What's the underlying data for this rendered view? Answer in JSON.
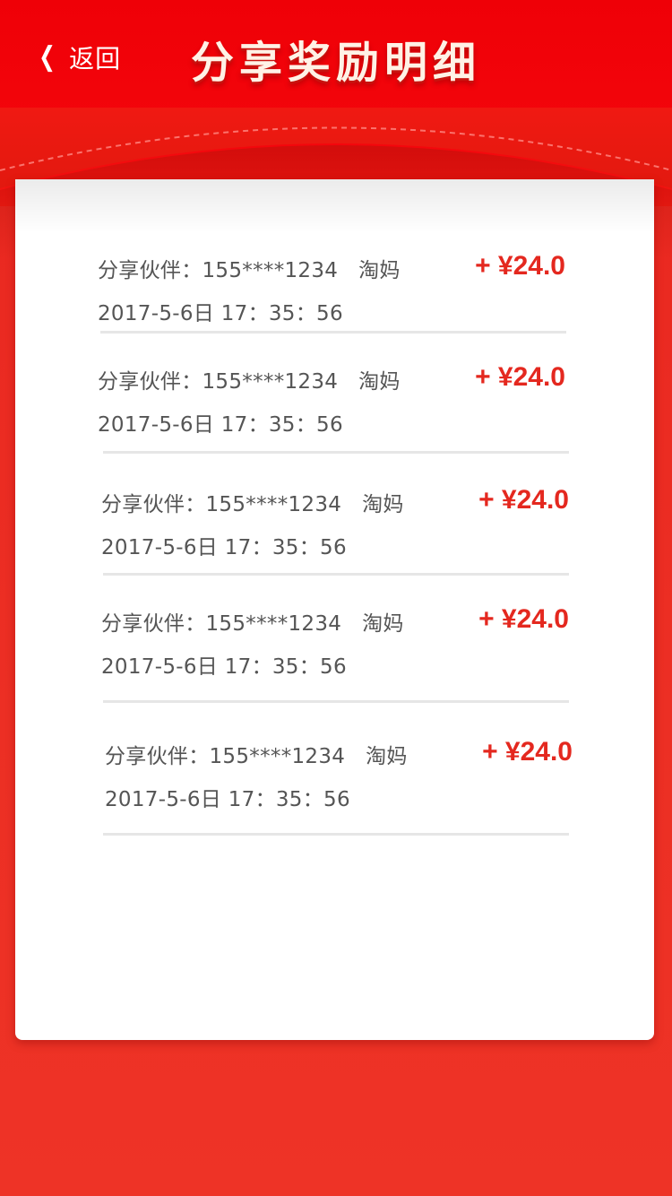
{
  "header": {
    "back_label": "返回",
    "back_icon": "chevron-left-icon",
    "title": "分享奖励明细"
  },
  "colors": {
    "header_red": "#f4060c",
    "background_red": "#ec2f24",
    "amount_red": "#e4281f",
    "text_gray": "#555555"
  },
  "records": [
    {
      "partner_label": "分享伙伴：",
      "phone": "155****1234",
      "platform": "淘妈",
      "time": "2017-5-6日 17：35：56",
      "amount": "+ ¥24.0"
    },
    {
      "partner_label": "分享伙伴：",
      "phone": "155****1234",
      "platform": "淘妈",
      "time": "2017-5-6日 17：35：56",
      "amount": "+ ¥24.0"
    },
    {
      "partner_label": "分享伙伴：",
      "phone": "155****1234",
      "platform": "淘妈",
      "time": "2017-5-6日 17：35：56",
      "amount": "+ ¥24.0"
    },
    {
      "partner_label": "分享伙伴：",
      "phone": "155****1234",
      "platform": "淘妈",
      "time": "2017-5-6日 17：35：56",
      "amount": "+ ¥24.0"
    },
    {
      "partner_label": "分享伙伴：",
      "phone": "155****1234",
      "platform": "淘妈",
      "time": "2017-5-6日 17：35：56",
      "amount": "+ ¥24.0"
    }
  ]
}
